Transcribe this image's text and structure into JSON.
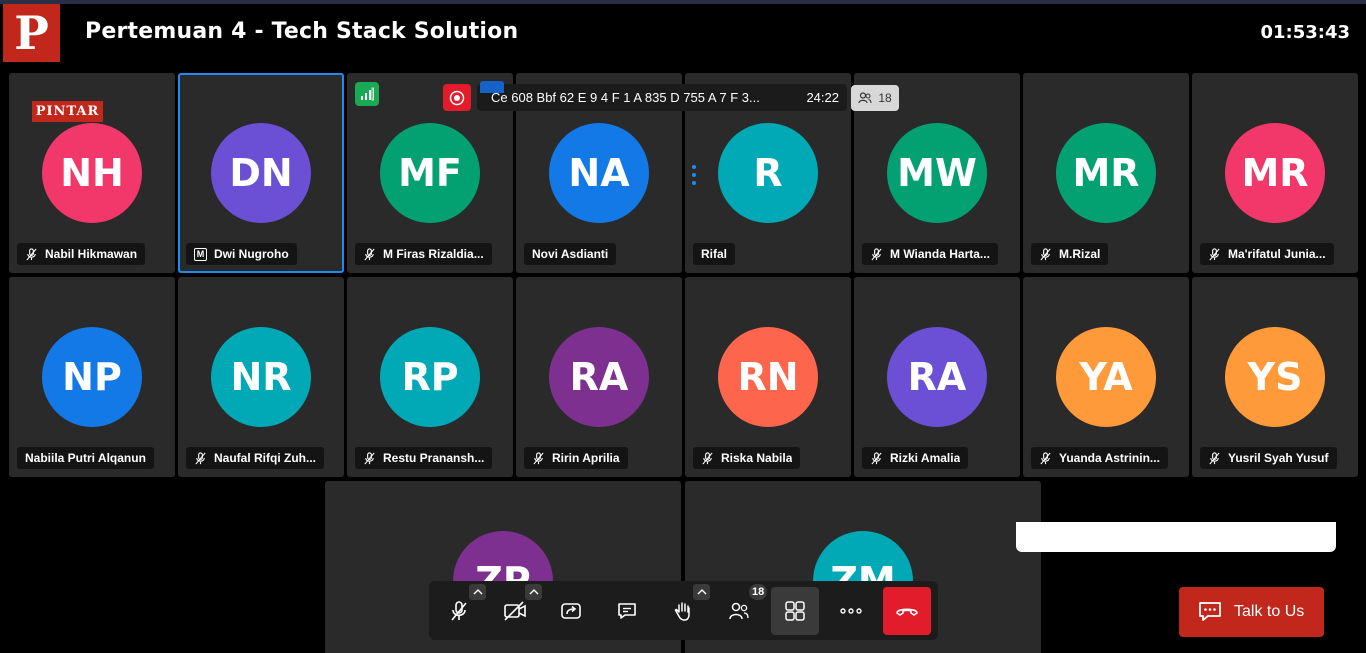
{
  "header": {
    "logo_text": "P",
    "title": "Pertemuan 4 - Tech Stack Solution",
    "clock": "01:53:43"
  },
  "brand_badge": "PINTAR",
  "meeting_info": {
    "room_id": "Ce 608 Bbf 62 E 9 4 F 1 A 835 D 755 A 7 F 3...",
    "elapsed": "24:22",
    "participant_count": "18"
  },
  "participants": [
    {
      "initials": "NH",
      "name": "Nabil Hikmawan",
      "color": "#f2386a",
      "muted": true
    },
    {
      "initials": "DN",
      "name": "Dwi Nugroho",
      "color": "#6b4fd4",
      "moderator": true,
      "moderator_mark": "M",
      "active": true
    },
    {
      "initials": "MF",
      "name": "M Firas Rizaldia...",
      "color": "#03a172",
      "muted": true
    },
    {
      "initials": "NA",
      "name": "Novi Asdianti",
      "color": "#1379e6"
    },
    {
      "initials": "R",
      "name": "Rifal",
      "color": "#00a9b5"
    },
    {
      "initials": "MW",
      "name": "M Wianda Harta...",
      "color": "#03a172",
      "muted": true
    },
    {
      "initials": "MR",
      "name": "M.Rizal",
      "color": "#03a172",
      "muted": true
    },
    {
      "initials": "MR",
      "name": "Ma'rifatul Junia...",
      "color": "#f2386a",
      "muted": true
    },
    {
      "initials": "NP",
      "name": "Nabiila Putri Alqanun",
      "color": "#1379e6"
    },
    {
      "initials": "NR",
      "name": "Naufal Rifqi Zuh...",
      "color": "#00a9b5",
      "muted": true
    },
    {
      "initials": "RP",
      "name": "Restu Pranansh...",
      "color": "#00a9b5",
      "muted": true
    },
    {
      "initials": "RA",
      "name": "Ririn Aprilia",
      "color": "#7d308f",
      "muted": true
    },
    {
      "initials": "RN",
      "name": "Riska Nabila",
      "color": "#fd654c",
      "muted": true
    },
    {
      "initials": "RA",
      "name": "Rizki Amalia",
      "color": "#6b4fd4",
      "muted": true
    },
    {
      "initials": "YA",
      "name": "Yuanda Astrinin...",
      "color": "#fe9a3a",
      "muted": true
    },
    {
      "initials": "YS",
      "name": "Yusril Syah Yusuf",
      "color": "#fe9a3a",
      "muted": true
    },
    {
      "initials": "ZP",
      "name": "",
      "color": "#7d308f"
    },
    {
      "initials": "ZM",
      "name": "",
      "color": "#00a9b5"
    }
  ],
  "toolbar": {
    "participants_badge": "18",
    "buttons": [
      "mic-muted-icon",
      "camera-off-icon",
      "share-screen-icon",
      "chat-icon",
      "raise-hand-icon",
      "participants-icon",
      "tile-view-icon",
      "more-icon",
      "hangup-icon"
    ]
  },
  "talk_to_us": {
    "label": "Talk to Us"
  },
  "colors": {
    "brand_red": "#c2271c",
    "active_border": "#1d8bf0",
    "leave_red": "#e31c2c"
  }
}
